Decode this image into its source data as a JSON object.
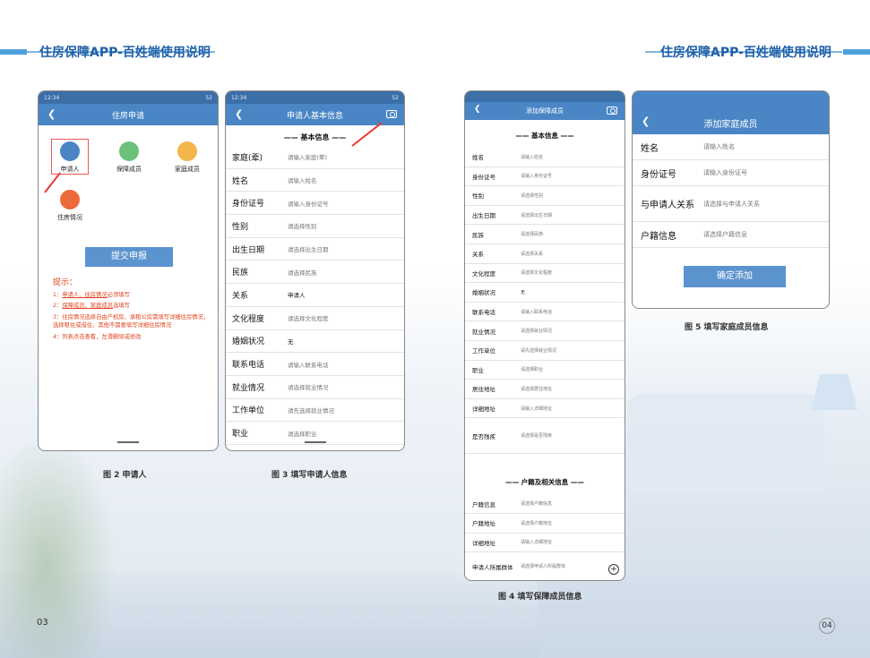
{
  "header": {
    "left_title": "住房保障APP-百姓端使用说明",
    "right_title": "住房保障APP-百姓端使用说明"
  },
  "pages": {
    "left": "03",
    "right": "04"
  },
  "fig2": {
    "status": {
      "time": "12:34",
      "right": "52"
    },
    "title": "住房申请",
    "icons": [
      {
        "label": "申请人"
      },
      {
        "label": "保障成员"
      },
      {
        "label": "家庭成员"
      },
      {
        "label": "住房情况"
      }
    ],
    "submit": "提交申报",
    "tips_title": "提示：",
    "tips": [
      {
        "num": "1：",
        "u": "申请人、住房情况",
        "rest": "必须填写"
      },
      {
        "num": "2：",
        "u": "保障成员、家庭成员",
        "rest": "选填写"
      },
      {
        "num": "3：",
        "u": "",
        "rest": "住房情况选择自由产权房、承租公房需填写详细住房情况，选择租住或借住、其他不需要填写详细住房情况"
      },
      {
        "num": "4：",
        "u": "",
        "rest": "列表点击查看，左滑删除或修改"
      }
    ],
    "caption": "图 2   申请人"
  },
  "fig3": {
    "status": {
      "time": "12:34",
      "right": "52"
    },
    "title": "申请人基本信息",
    "section": "—— 基本信息 ——",
    "rows": [
      {
        "label": "家庭(辈)",
        "value": "请输入家庭(辈)"
      },
      {
        "label": "姓名",
        "value": "请输入姓名"
      },
      {
        "label": "身份证号",
        "value": "请输入身份证号"
      },
      {
        "label": "性别",
        "value": "请选择性别"
      },
      {
        "label": "出生日期",
        "value": "请选择出生日期"
      },
      {
        "label": "民族",
        "value": "请选择民族"
      },
      {
        "label": "关系",
        "value": "申请人"
      },
      {
        "label": "文化程度",
        "value": "请选择文化程度"
      },
      {
        "label": "婚姻状况",
        "value": "无"
      },
      {
        "label": "联系电话",
        "value": "请输入联系电话"
      },
      {
        "label": "就业情况",
        "value": "请选择就业情况"
      },
      {
        "label": "工作单位",
        "value": "请先选择就业情况"
      },
      {
        "label": "职业",
        "value": "请选择职业"
      }
    ],
    "caption": "图 3   填写申请人信息"
  },
  "fig4": {
    "title": "添加保障成员",
    "section1": "—— 基本信息 ——",
    "rows1": [
      {
        "label": "姓名",
        "value": "请输入姓名"
      },
      {
        "label": "身份证号",
        "value": "请输入身份证号"
      },
      {
        "label": "性别",
        "value": "请选择性别"
      },
      {
        "label": "出生日期",
        "value": "请选择出生日期"
      },
      {
        "label": "民族",
        "value": "请选择民族"
      },
      {
        "label": "关系",
        "value": "请选择关系"
      },
      {
        "label": "文化程度",
        "value": "请选择文化程度"
      },
      {
        "label": "婚姻状况",
        "value": "无"
      },
      {
        "label": "联系电话",
        "value": "请输入联系电话"
      },
      {
        "label": "就业情况",
        "value": "请选择就业情况"
      },
      {
        "label": "工作单位",
        "value": "请先选择就业情况"
      },
      {
        "label": "职业",
        "value": "请选择职业"
      },
      {
        "label": "居住地址",
        "value": "请选择居住地址"
      },
      {
        "label": "详细地址",
        "value": "请输入详细地址"
      },
      {
        "label": "是否残疾",
        "value": "请选择是否残疾"
      }
    ],
    "section2": "—— 户籍及相关信息 ——",
    "rows2": [
      {
        "label": "户籍信息",
        "value": "请选择户籍信息"
      },
      {
        "label": "户籍地址",
        "value": "请选择户籍地址"
      },
      {
        "label": "详细地址",
        "value": "请输入详细地址"
      },
      {
        "label": "申请人所属群体",
        "value": "请选择申请人所属群体"
      }
    ],
    "caption": "图 4   填写保障成员信息"
  },
  "fig5": {
    "title": "添加家庭成员",
    "rows": [
      {
        "label": "姓名",
        "value": "请输入姓名"
      },
      {
        "label": "身份证号",
        "value": "请输入身份证号"
      },
      {
        "label": "与申请人关系",
        "value": "请选择与申请人关系"
      },
      {
        "label": "户籍信息",
        "value": "请选择户籍信息"
      }
    ],
    "button": "确定添加",
    "caption": "图 5   填写家庭成员信息"
  }
}
